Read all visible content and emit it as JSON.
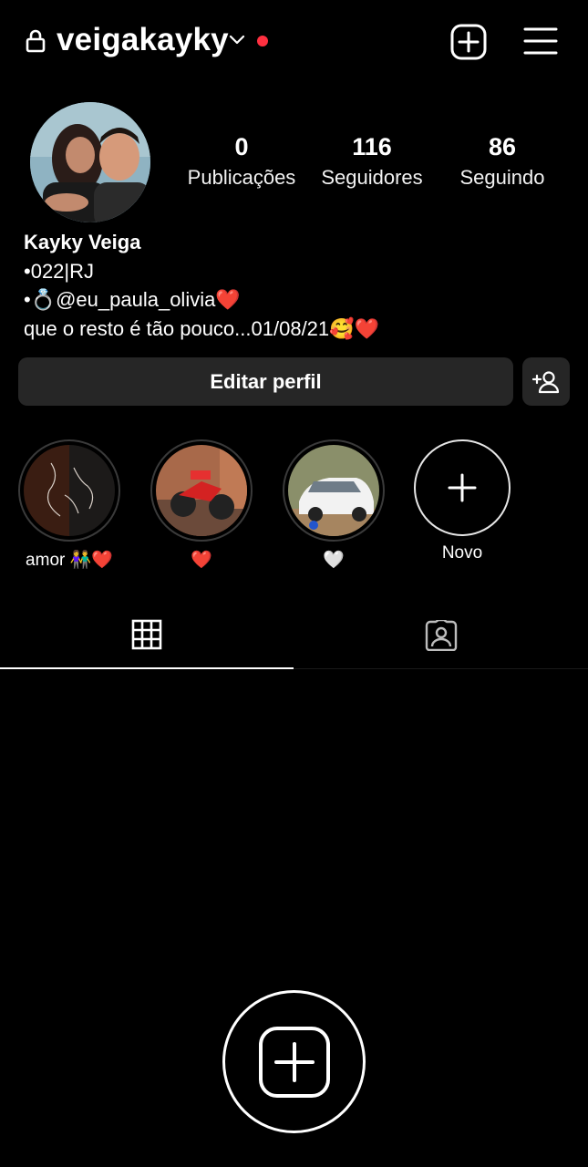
{
  "header": {
    "username": "veigakayky",
    "lock_icon": "lock-icon",
    "switch_account_icon": "chevron-down-icon",
    "notification_dot_color": "#ff3040",
    "new_post_icon": "plus-square-icon",
    "menu_icon": "hamburger-menu-icon"
  },
  "profile": {
    "stats": [
      {
        "value": "0",
        "label": "Publicações"
      },
      {
        "value": "116",
        "label": "Seguidores"
      },
      {
        "value": "86",
        "label": "Seguindo"
      }
    ],
    "name": "Kayky Veiga",
    "bio": [
      "•022|RJ",
      "•💍@eu_paula_olivia❤️",
      "que o resto é tão pouco...01/08/21🥰❤️"
    ]
  },
  "actions": {
    "edit_profile_label": "Editar perfil",
    "discover_people_icon": "add-person-icon"
  },
  "highlights": [
    {
      "label": "amor 👫❤️"
    },
    {
      "label": "❤️"
    },
    {
      "label": "🤍"
    },
    {
      "label": "Novo"
    }
  ],
  "tabs": [
    {
      "icon": "grid-icon",
      "selected": true
    },
    {
      "icon": "tagged-person-icon",
      "selected": false
    }
  ],
  "empty_state": {
    "icon": "add-post-icon"
  },
  "colors": {
    "background": "#000000",
    "button": "#262626",
    "accent_dot": "#ff3040"
  }
}
